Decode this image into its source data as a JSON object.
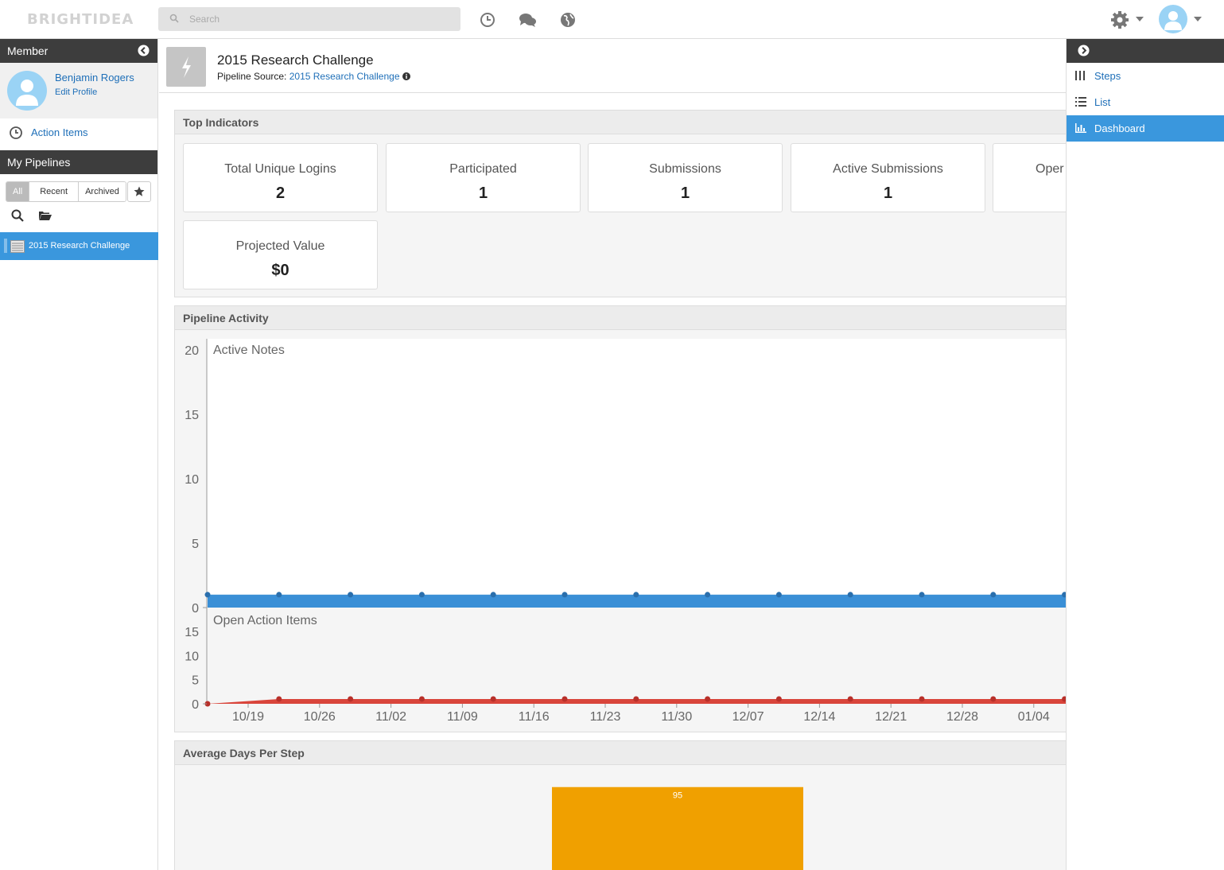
{
  "app": {
    "logo": "BRIGHTIDEA"
  },
  "search": {
    "placeholder": "Search"
  },
  "left_panel": {
    "member_header": "Member",
    "user_name": "Benjamin Rogers",
    "edit_profile": "Edit Profile",
    "action_items": "Action Items",
    "pipelines_header": "My Pipelines",
    "filters": [
      "All",
      "Recent",
      "Archived"
    ],
    "selected_filter": "All",
    "pipeline_item": "2015 Research Challenge"
  },
  "header": {
    "title": "2015 Research Challenge",
    "source_label": "Pipeline Source:",
    "source_link": "2015 Research Challenge"
  },
  "top_indicators": {
    "title": "Top Indicators",
    "cards": [
      {
        "label": "Total Unique Logins",
        "value": "2"
      },
      {
        "label": "Participated",
        "value": "1"
      },
      {
        "label": "Submissions",
        "value": "1"
      },
      {
        "label": "Active Submissions",
        "value": "1"
      },
      {
        "label": "Oper",
        "value": ""
      },
      {
        "label": "Projected Value",
        "value": "$0"
      }
    ]
  },
  "pipeline_activity": {
    "title": "Pipeline Activity"
  },
  "avg_days": {
    "title": "Average Days Per Step"
  },
  "right_panel": {
    "items": [
      "Steps",
      "List",
      "Dashboard"
    ],
    "active": "Dashboard"
  },
  "colors": {
    "accent": "#3a97dd",
    "active_notes": "#3a8fd6",
    "open_actions": "#d9453b",
    "bar": "#f0a000"
  },
  "chart_data": [
    {
      "type": "area",
      "title": "Active Notes",
      "x": [
        "10/15",
        "10/22",
        "10/29",
        "11/05",
        "11/12",
        "11/19",
        "11/26",
        "12/03",
        "12/10",
        "12/17",
        "12/24",
        "12/31",
        "01/07"
      ],
      "y": [
        1,
        1,
        1,
        1,
        1,
        1,
        1,
        1,
        1,
        1,
        1,
        1,
        1
      ],
      "ylim": [
        0,
        20
      ],
      "yticks": [
        0,
        5,
        10,
        15,
        20
      ]
    },
    {
      "type": "area",
      "title": "Open Action Items",
      "x": [
        "10/15",
        "10/22",
        "10/29",
        "11/05",
        "11/12",
        "11/19",
        "11/26",
        "12/03",
        "12/10",
        "12/17",
        "12/24",
        "12/31",
        "01/07"
      ],
      "y": [
        0,
        1,
        1,
        1,
        1,
        1,
        1,
        1,
        1,
        1,
        1,
        1,
        1
      ],
      "ylim": [
        0,
        18
      ],
      "yticks": [
        0,
        5,
        10,
        15
      ],
      "xticks": [
        "10/19",
        "10/26",
        "11/02",
        "11/09",
        "11/16",
        "11/23",
        "11/30",
        "12/07",
        "12/14",
        "12/21",
        "12/28",
        "01/04"
      ]
    },
    {
      "type": "bar",
      "title": "Average Days Per Step",
      "values": [
        95
      ],
      "labels": [
        "95"
      ]
    }
  ]
}
